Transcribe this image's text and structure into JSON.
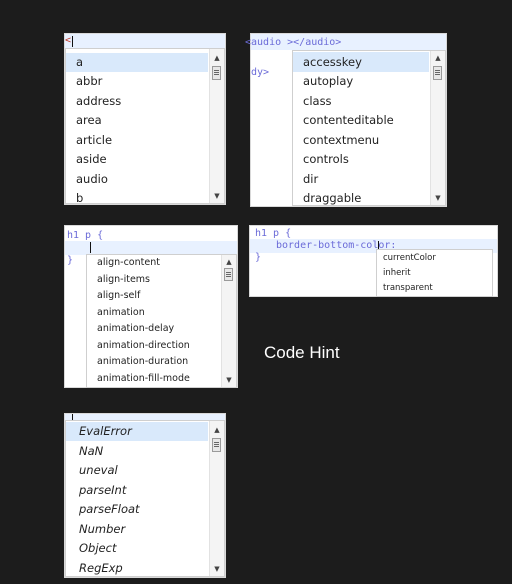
{
  "caption": "Code Hint",
  "panel_html_tags": {
    "code_line": "<",
    "items": [
      "a",
      "abbr",
      "address",
      "area",
      "article",
      "aside",
      "audio",
      "b"
    ]
  },
  "panel_attributes": {
    "code_line1": "<audio ></audio>",
    "code_line2": "dy>",
    "items": [
      "accesskey",
      "autoplay",
      "class",
      "contenteditable",
      "contextmenu",
      "controls",
      "dir",
      "draggable"
    ]
  },
  "panel_css_props": {
    "code_line1": "h1 p {",
    "code_line2": "}",
    "items": [
      "align-content",
      "align-items",
      "align-self",
      "animation",
      "animation-delay",
      "animation-direction",
      "animation-duration",
      "animation-fill-mode"
    ]
  },
  "panel_css_values": {
    "code_line1": "h1 p {",
    "code_line2": "border-bottom-color:",
    "code_line3": "}",
    "items": [
      "currentColor",
      "inherit",
      "transparent"
    ]
  },
  "panel_js": {
    "items": [
      "EvalError",
      "NaN",
      "uneval",
      "parseInt",
      "parseFloat",
      "Number",
      "Object",
      "RegExp"
    ]
  }
}
